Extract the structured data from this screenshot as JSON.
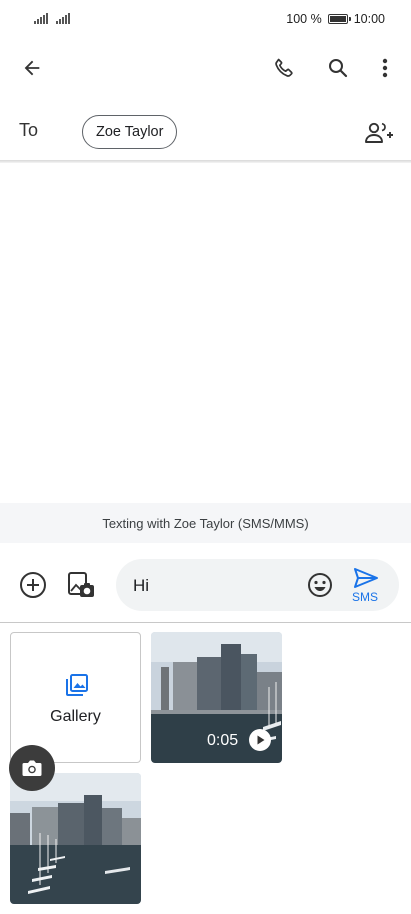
{
  "status_bar": {
    "battery": "100 %",
    "time": "10:00",
    "battery_level": 1.0
  },
  "top_bar": {
    "back_icon": "arrow-back-icon",
    "call_icon": "phone-icon",
    "search_icon": "search-icon",
    "more_icon": "more-vert-icon"
  },
  "recipients": {
    "to_label": "To",
    "chip_name": "Zoe Taylor",
    "add_contact_icon": "person-add-icon"
  },
  "banner": {
    "text": "Texting with Zoe Taylor (SMS/MMS)"
  },
  "compose": {
    "add_icon": "add-circle-icon",
    "gallery_icon": "gallery-camera-icon",
    "message_value": "Hi",
    "emoji_icon": "emoji-icon",
    "send_icon": "send-icon",
    "send_label": "SMS",
    "accent": "#1a73e8"
  },
  "media": {
    "gallery_label": "Gallery",
    "gallery_icon": "photo-library-icon",
    "video_duration": "0:05",
    "play_icon": "play-icon",
    "camera_icon": "camera-icon"
  }
}
